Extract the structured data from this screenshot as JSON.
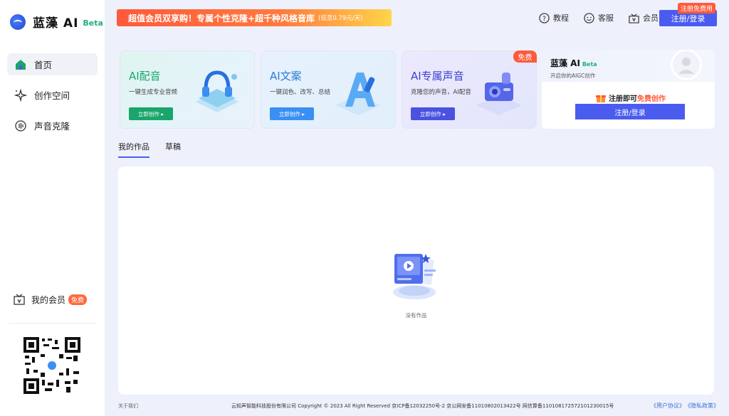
{
  "app": {
    "name": "蓝藻 AI",
    "beta": "Beta"
  },
  "sidebar": {
    "items": [
      {
        "label": "首页",
        "icon": "home-icon",
        "active": true
      },
      {
        "label": "创作空间",
        "icon": "sparkle-icon",
        "active": false
      },
      {
        "label": "声音克隆",
        "icon": "voice-clone-icon",
        "active": false
      }
    ],
    "member": {
      "label": "我的会员",
      "badge": "免费"
    }
  },
  "header": {
    "banner": {
      "main": "超值会员双享购！专属个性克隆+超千种风格音库",
      "sub": "(低至0.79元/天)"
    },
    "links": [
      {
        "label": "教程",
        "icon": "help-icon"
      },
      {
        "label": "客服",
        "icon": "service-icon"
      },
      {
        "label": "会员",
        "icon": "vip-icon"
      }
    ],
    "login": "注册/登录",
    "login_badge": "注册免费用"
  },
  "cards": [
    {
      "title": "AI配音",
      "desc": "一键生成专业音频",
      "button": "立即创作 ▸"
    },
    {
      "title": "AI文案",
      "desc": "一键润色、改写、总结",
      "button": "立即创作 ▸"
    },
    {
      "title": "AI专属声音",
      "desc": "克隆您的声音，AI配音",
      "button": "立即创作 ▸",
      "badge": "免费"
    }
  ],
  "promo": {
    "title": "蓝藻 AI",
    "beta": "Beta",
    "subtitle": "开启你的AIGC创作",
    "hint_prefix": "注册即可",
    "hint_highlight": "免费创作",
    "button": "注册/登录"
  },
  "tabs": [
    {
      "label": "我的作品",
      "active": true
    },
    {
      "label": "草稿",
      "active": false
    }
  ],
  "panel": {
    "empty_text": "没有作品"
  },
  "footer": {
    "about": "关于我们",
    "copyright": "云知声智能科技股份有限公司 Copyright © 2023 All Right Reserved 京ICP备12032250号-2 京公网安备11010802013422号 网信算备110108172572101230015号",
    "agreement": "《用户协议》",
    "privacy": "《隐私政策》"
  },
  "colors": {
    "accent": "#4a5cf0",
    "green": "#1aa56b",
    "badge": "#ff5a3b"
  }
}
